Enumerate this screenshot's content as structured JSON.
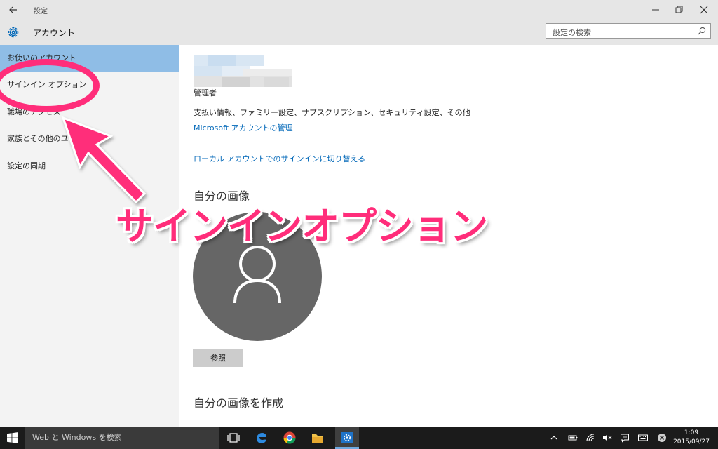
{
  "window": {
    "title": "設定",
    "app_title": "アカウント",
    "icons": {
      "back": "back-arrow-icon",
      "gear": "gear-icon",
      "minimize": "minimize-icon",
      "maximize": "maximize-icon",
      "close": "close-icon"
    }
  },
  "search": {
    "placeholder": "設定の検索",
    "icon": "search-icon"
  },
  "sidebar": {
    "items": [
      {
        "label": "お使いのアカウント",
        "active": true
      },
      {
        "label": "サインイン オプション",
        "active": false
      },
      {
        "label": "職場のアクセス",
        "active": false
      },
      {
        "label": "家族とその他のユーザー",
        "active": false
      },
      {
        "label": "設定の同期",
        "active": false
      }
    ]
  },
  "main": {
    "role": "管理者",
    "description": "支払い情報、ファミリー設定、サブスクリプション、セキュリティ設定、その他",
    "manage_link": "Microsoft アカウントの管理",
    "switch_local_link": "ローカル アカウントでのサインインに切り替える",
    "picture_heading": "自分の画像",
    "browse_button": "参照",
    "create_heading": "自分の画像を作成"
  },
  "annotation": {
    "text": "サインインオプション",
    "color": "#ff2d7a"
  },
  "taskbar": {
    "search_placeholder": "Web と Windows を検索",
    "apps": [
      "task-view-icon",
      "edge-icon",
      "chrome-icon",
      "file-explorer-icon",
      "settings-icon"
    ],
    "tray": [
      "chevron-up-icon",
      "battery-icon",
      "wifi-icon",
      "volume-muted-icon",
      "notification-icon",
      "keyboard-icon"
    ],
    "time": "1:09",
    "date": "2015/09/27"
  },
  "colors": {
    "accent": "#0067b8",
    "sidebar_active": "#8fbde6",
    "taskbar": "#1b1b1b"
  }
}
